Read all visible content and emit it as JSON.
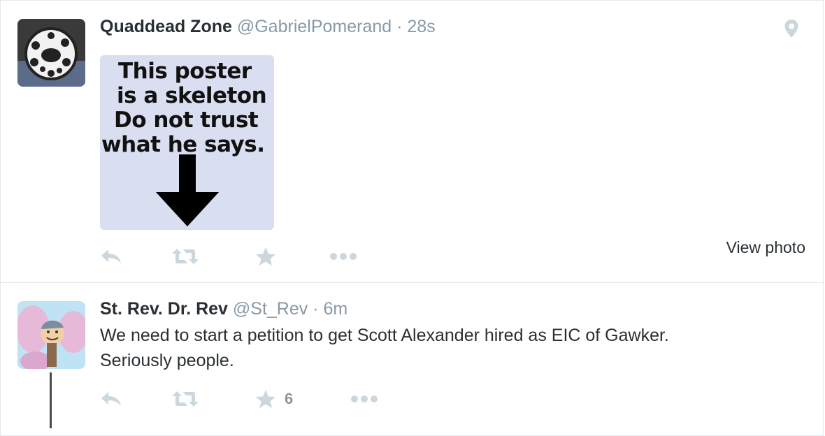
{
  "tweets": [
    {
      "fullname": "Quaddead Zone",
      "username": "@GabrielPomerand",
      "separator": "·",
      "time": "28s",
      "media_text": [
        "This poster",
        "is a skeleton",
        "Do not trust",
        "what he says."
      ],
      "view_photo": "View photo"
    },
    {
      "fullname": "St. Rev. Dr. Rev",
      "username": "@St_Rev",
      "separator": "·",
      "time": "6m",
      "text_line1": "We need to start a petition to get Scott Alexander hired as EIC of Gawker.",
      "text_line2": "Seriously people.",
      "favorite_count": "6"
    }
  ],
  "icons": {
    "reply": "reply-icon",
    "retweet": "retweet-icon",
    "favorite": "star-icon",
    "more": "more-dots-icon",
    "location": "location-pin-icon"
  },
  "colors": {
    "text": "#292f33",
    "muted": "#8899a6",
    "action_icon": "#ccd6dd",
    "border": "#e1e8ed",
    "media_bg": "#d9def0"
  }
}
